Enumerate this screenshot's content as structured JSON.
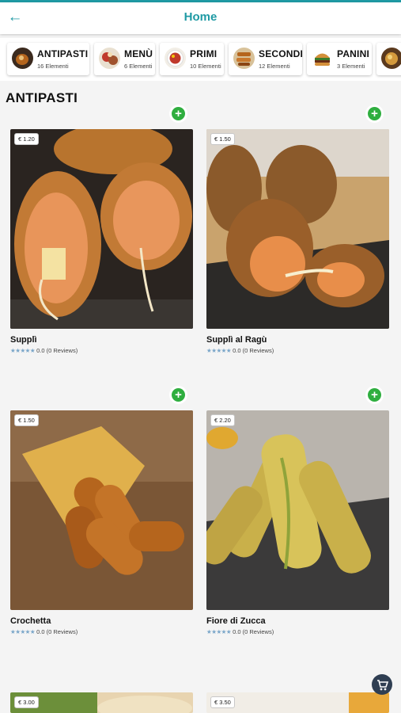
{
  "header": {
    "title": "Home",
    "back_icon": "arrow-left-icon",
    "accent": "#1f9aa4"
  },
  "categories": [
    {
      "name": "ANTIPASTI",
      "count": "16 Elementi"
    },
    {
      "name": "MENÙ",
      "count": "6 Elementi"
    },
    {
      "name": "PRIMI",
      "count": "10 Elementi"
    },
    {
      "name": "SECONDI",
      "count": "12 Elementi"
    },
    {
      "name": "PANINI",
      "count": "3 Elementi"
    }
  ],
  "section": {
    "title": "ANTIPASTI"
  },
  "products": [
    {
      "name": "Supplì",
      "price": "€ 1.20",
      "rating": "0.0 (0 Reviews)"
    },
    {
      "name": "Supplì al Ragù",
      "price": "€ 1.50",
      "rating": "0.0 (0 Reviews)"
    },
    {
      "name": "Crochetta",
      "price": "€ 1.50",
      "rating": "0.0 (0 Reviews)"
    },
    {
      "name": "Fiore di Zucca",
      "price": "€ 2.20",
      "rating": "0.0 (0 Reviews)"
    },
    {
      "price": "€ 3.00"
    },
    {
      "price": "€ 3.50"
    }
  ],
  "icons": {
    "add": "plus-circle-icon",
    "cart": "cart-icon",
    "star": "star-icon"
  },
  "colors": {
    "add_button": "#2fae3f",
    "cart_button": "#2f3e52"
  }
}
